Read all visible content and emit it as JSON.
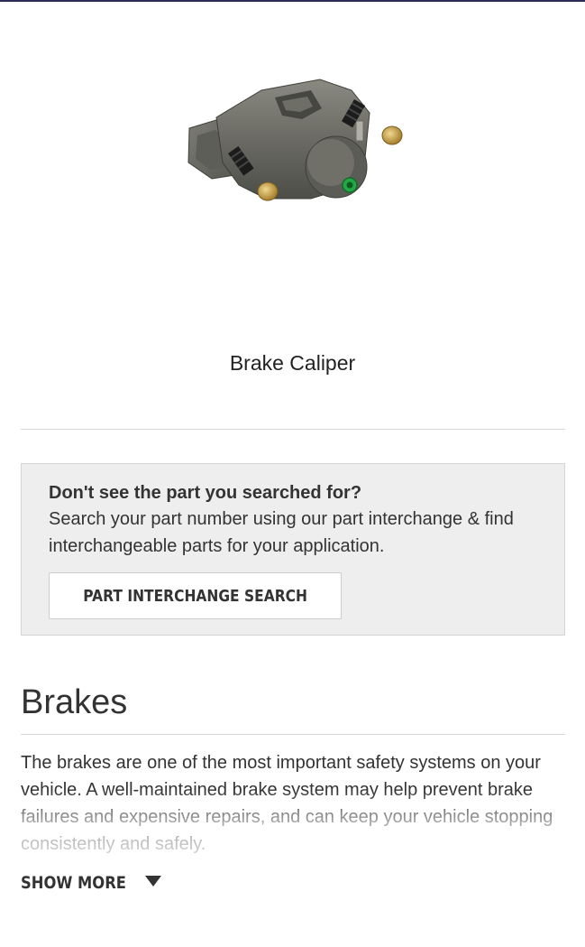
{
  "product": {
    "name": "Brake Caliper",
    "image_icon": "brake-caliper-image"
  },
  "interchange": {
    "heading": "Don't see the part you searched for?",
    "text": "Search your part number using our part interchange & find interchangeable parts for your application.",
    "button_label": "PART INTERCHANGE SEARCH"
  },
  "section": {
    "title": "Brakes",
    "description": "The brakes are one of the most important safety systems on your vehicle. A well-maintained brake system may help prevent brake failures and expensive repairs, and can keep your vehicle stopping consistently and safely.",
    "show_more_label": "SHOW MORE",
    "show_more_icon": "caret-down-icon"
  },
  "colors": {
    "top_rule": "#2b2a5a",
    "box_background": "#eeeeee",
    "text": "#333333",
    "caliper_green": "#22a845",
    "caliper_gold": "#c9a24a"
  }
}
